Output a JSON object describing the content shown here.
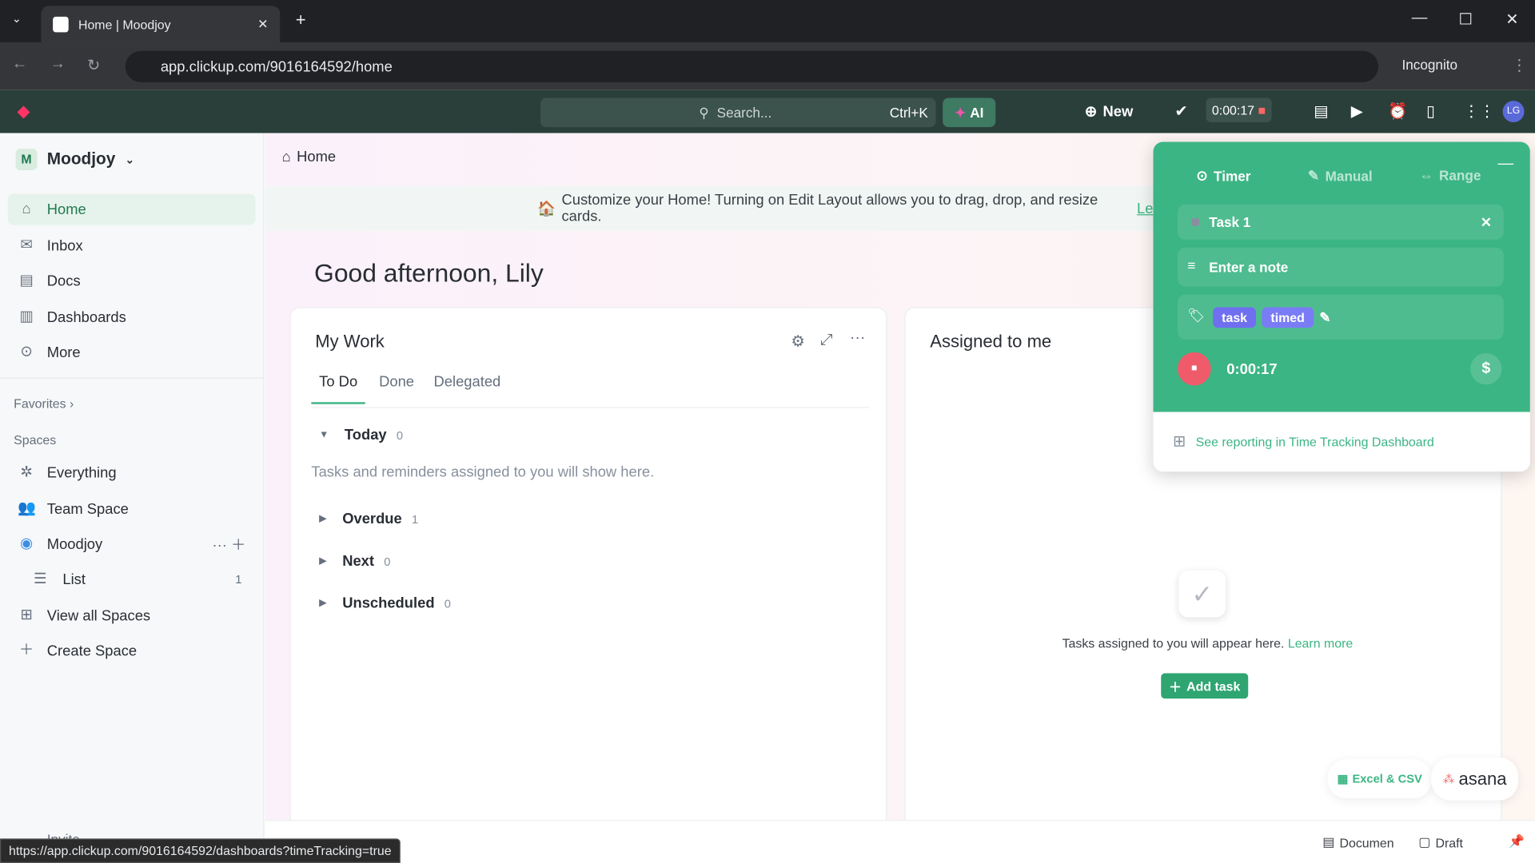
{
  "browser": {
    "tab_title": "Home | Moodjoy",
    "url": "app.clickup.com/9016164592/home",
    "profile": "Incognito",
    "status_url": "https://app.clickup.com/9016164592/dashboards?timeTracking=true"
  },
  "topbar": {
    "search_placeholder": "Search...",
    "shortcut": "Ctrl+K",
    "ai": "AI",
    "new": "New",
    "timer": "0:00:17",
    "avatar": "LG"
  },
  "sidebar": {
    "workspace_initial": "M",
    "workspace": "Moodjoy",
    "nav": [
      {
        "label": "Home",
        "icon": "home-icon"
      },
      {
        "label": "Inbox",
        "icon": "inbox-icon"
      },
      {
        "label": "Docs",
        "icon": "docs-icon"
      },
      {
        "label": "Dashboards",
        "icon": "dashboards-icon"
      },
      {
        "label": "More",
        "icon": "more-icon"
      }
    ],
    "favorites": "Favorites",
    "spaces": "Spaces",
    "space_items": [
      {
        "label": "Everything"
      },
      {
        "label": "Team Space"
      },
      {
        "label": "Moodjoy"
      },
      {
        "label": "List",
        "count": "1"
      },
      {
        "label": "View all Spaces"
      },
      {
        "label": "Create Space"
      }
    ],
    "invite": "Invite"
  },
  "main": {
    "breadcrumb": "Home",
    "banner": "Customize your Home! Turning on Edit Layout allows you to drag, drop, and resize cards.",
    "banner_link": "Le",
    "greeting": "Good afternoon, Lily"
  },
  "my_work": {
    "title": "My Work",
    "tabs": [
      "To Do",
      "Done",
      "Delegated"
    ],
    "empty": "Tasks and reminders assigned to you will show here.",
    "groups": [
      {
        "label": "Today",
        "count": "0"
      },
      {
        "label": "Overdue",
        "count": "1"
      },
      {
        "label": "Next",
        "count": "0"
      },
      {
        "label": "Unscheduled",
        "count": "0"
      }
    ]
  },
  "assigned": {
    "title": "Assigned to me",
    "empty": "Tasks assigned to you will appear here.",
    "learn_more": "Learn more",
    "add_task": "Add task"
  },
  "timer_popup": {
    "tabs": [
      "Timer",
      "Manual",
      "Range"
    ],
    "task": "Task 1",
    "note_placeholder": "Enter a note",
    "tags": [
      "task",
      "timed"
    ],
    "elapsed": "0:00:17",
    "reporting": "See reporting in Time Tracking Dashboard",
    "accent": "#3cb584"
  },
  "imports": {
    "excel": "Excel & CSV",
    "asana": "asana"
  },
  "footer": {
    "document": "Documen",
    "draft": "Draft"
  }
}
